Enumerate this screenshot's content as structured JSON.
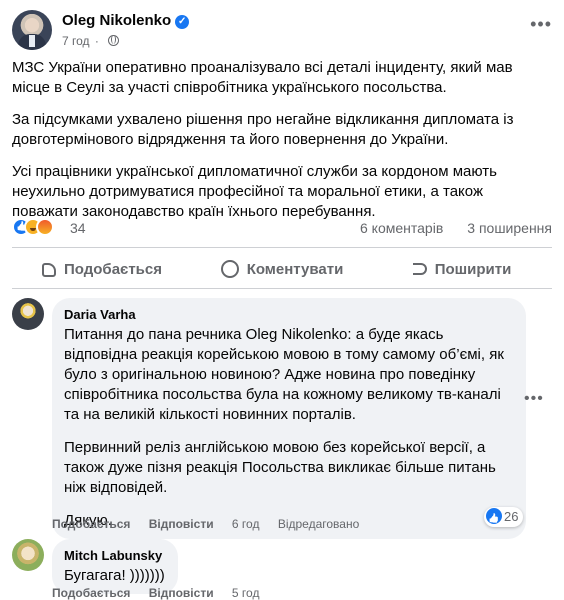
{
  "post": {
    "author": "Oleg Nikolenko",
    "time": "7 год",
    "paragraphs": [
      "МЗС України оперативно проаналізувало всі деталі інциденту, який мав місце в Сеулі за участі співробітника українського посольства.",
      "За підсумками ухвалено рішення про негайне відкликання дипломата із довготермінового відрядження та його повернення до України.",
      "Усі працівники української дипломатичної служби за кордоном мають неухильно дотримуватися професійної та моральної етики, а також поважати законодавство країн їхнього перебування."
    ],
    "reactions_count": "34",
    "comments_count": "6 коментарів",
    "shares_count": "3 поширення"
  },
  "actions": {
    "like": "Подобається",
    "comment": "Коментувати",
    "share": "Поширити"
  },
  "comments": [
    {
      "name": "Daria Varha",
      "paragraphs": [
        "Питання до пана речника Oleg Nikolenko: а буде якась відповідна реакція корейською мовою в тому самому об’ємі, як було з оригінальною новиною? Адже новина про поведінку співробітника посольства була на кожному великому тв-каналі та на великій кількості новинних порталів.",
        "Первинний реліз англійською мовою без корейської версії, а також дуже пізня реакція Посольства викликає більше питань ніж відповідей.",
        "Дякую."
      ],
      "like": "Подобається",
      "reply": "Відповісти",
      "time": "6 год",
      "edited": "Відредаговано",
      "reactions": "26"
    },
    {
      "name": "Mitch Labunsky",
      "text": "Бугагага! )))))))",
      "like": "Подобається",
      "reply": "Відповісти",
      "time": "5 год"
    }
  ],
  "icons": {
    "verified": "verified-badge-icon",
    "privacy": "globe-icon",
    "more": "more-options-icon",
    "like": "thumbs-up-icon",
    "comment": "comment-bubble-icon",
    "share": "share-arrow-icon"
  },
  "colors": {
    "accent": "#1877f2",
    "secondary_text": "#65676b",
    "bubble_bg": "#f0f2f5"
  }
}
